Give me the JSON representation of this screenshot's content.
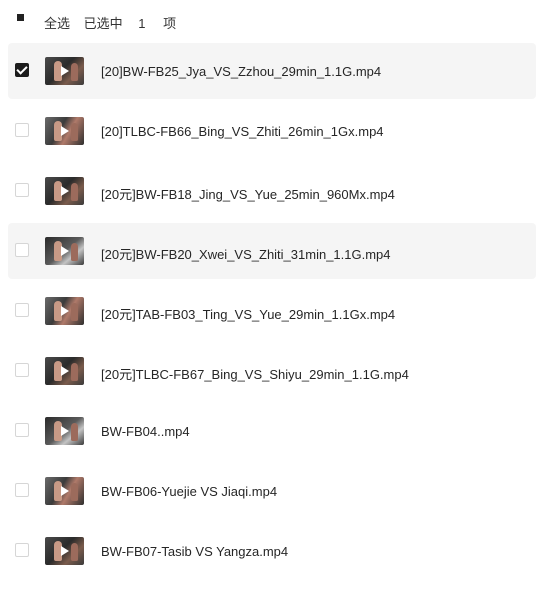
{
  "header": {
    "select_all_label": "全选",
    "selected_prefix": "已选中",
    "selected_count": "1",
    "selected_suffix": "项"
  },
  "files": [
    {
      "name": "[20]BW-FB25_Jya_VS_Zzhou_29min_1.1G.mp4",
      "checked": true,
      "highlighted": true
    },
    {
      "name": "[20]TLBC-FB66_Bing_VS_Zhiti_26min_1Gx.mp4",
      "checked": false,
      "highlighted": false
    },
    {
      "name": "[20元]BW-FB18_Jing_VS_Yue_25min_960Mx.mp4",
      "checked": false,
      "highlighted": false
    },
    {
      "name": "[20元]BW-FB20_Xwei_VS_Zhiti_31min_1.1G.mp4",
      "checked": false,
      "highlighted": true
    },
    {
      "name": "[20元]TAB-FB03_Ting_VS_Yue_29min_1.1Gx.mp4",
      "checked": false,
      "highlighted": false
    },
    {
      "name": "[20元]TLBC-FB67_Bing_VS_Shiyu_29min_1.1G.mp4",
      "checked": false,
      "highlighted": false
    },
    {
      "name": "BW-FB04..mp4",
      "checked": false,
      "highlighted": false
    },
    {
      "name": "BW-FB06-Yuejie VS Jiaqi.mp4",
      "checked": false,
      "highlighted": false
    },
    {
      "name": "BW-FB07-Tasib VS Yangza.mp4",
      "checked": false,
      "highlighted": false
    }
  ]
}
